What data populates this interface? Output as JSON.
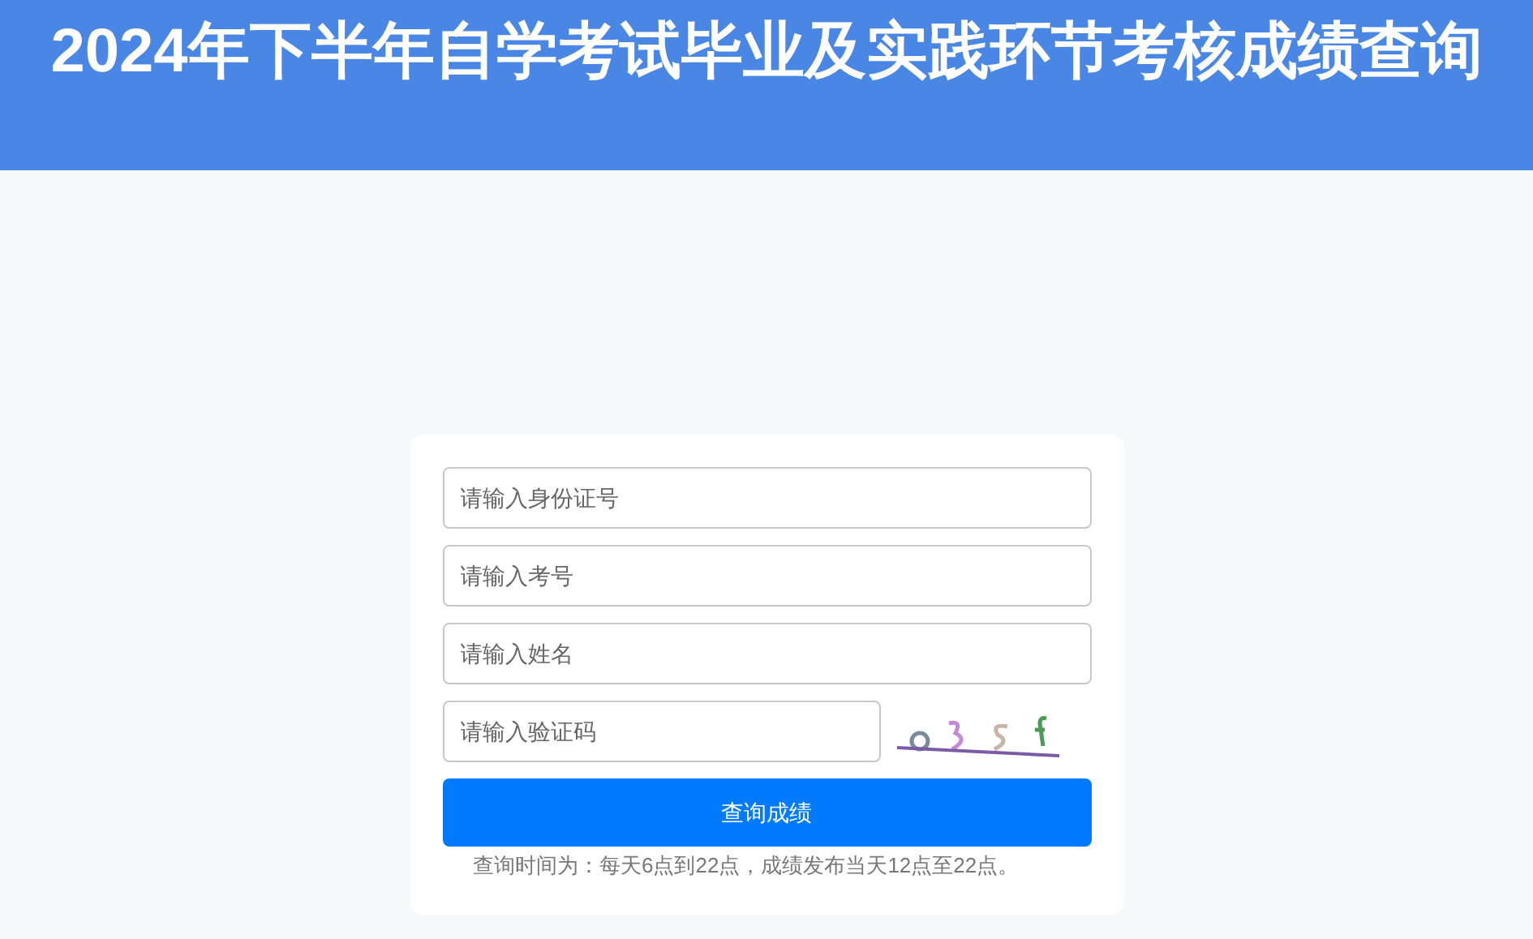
{
  "header": {
    "title": "2024年下半年自学考试毕业及实践环节考核成绩查询"
  },
  "form": {
    "fields": [
      {
        "placeholder": "请输入身份证号"
      },
      {
        "placeholder": "请输入考号"
      },
      {
        "placeholder": "请输入姓名"
      }
    ],
    "captcha": {
      "placeholder": "请输入验证码"
    },
    "submit": "查询成绩",
    "note": "查询时间为：每天6点到22点，成绩发布当天12点至22点。"
  }
}
